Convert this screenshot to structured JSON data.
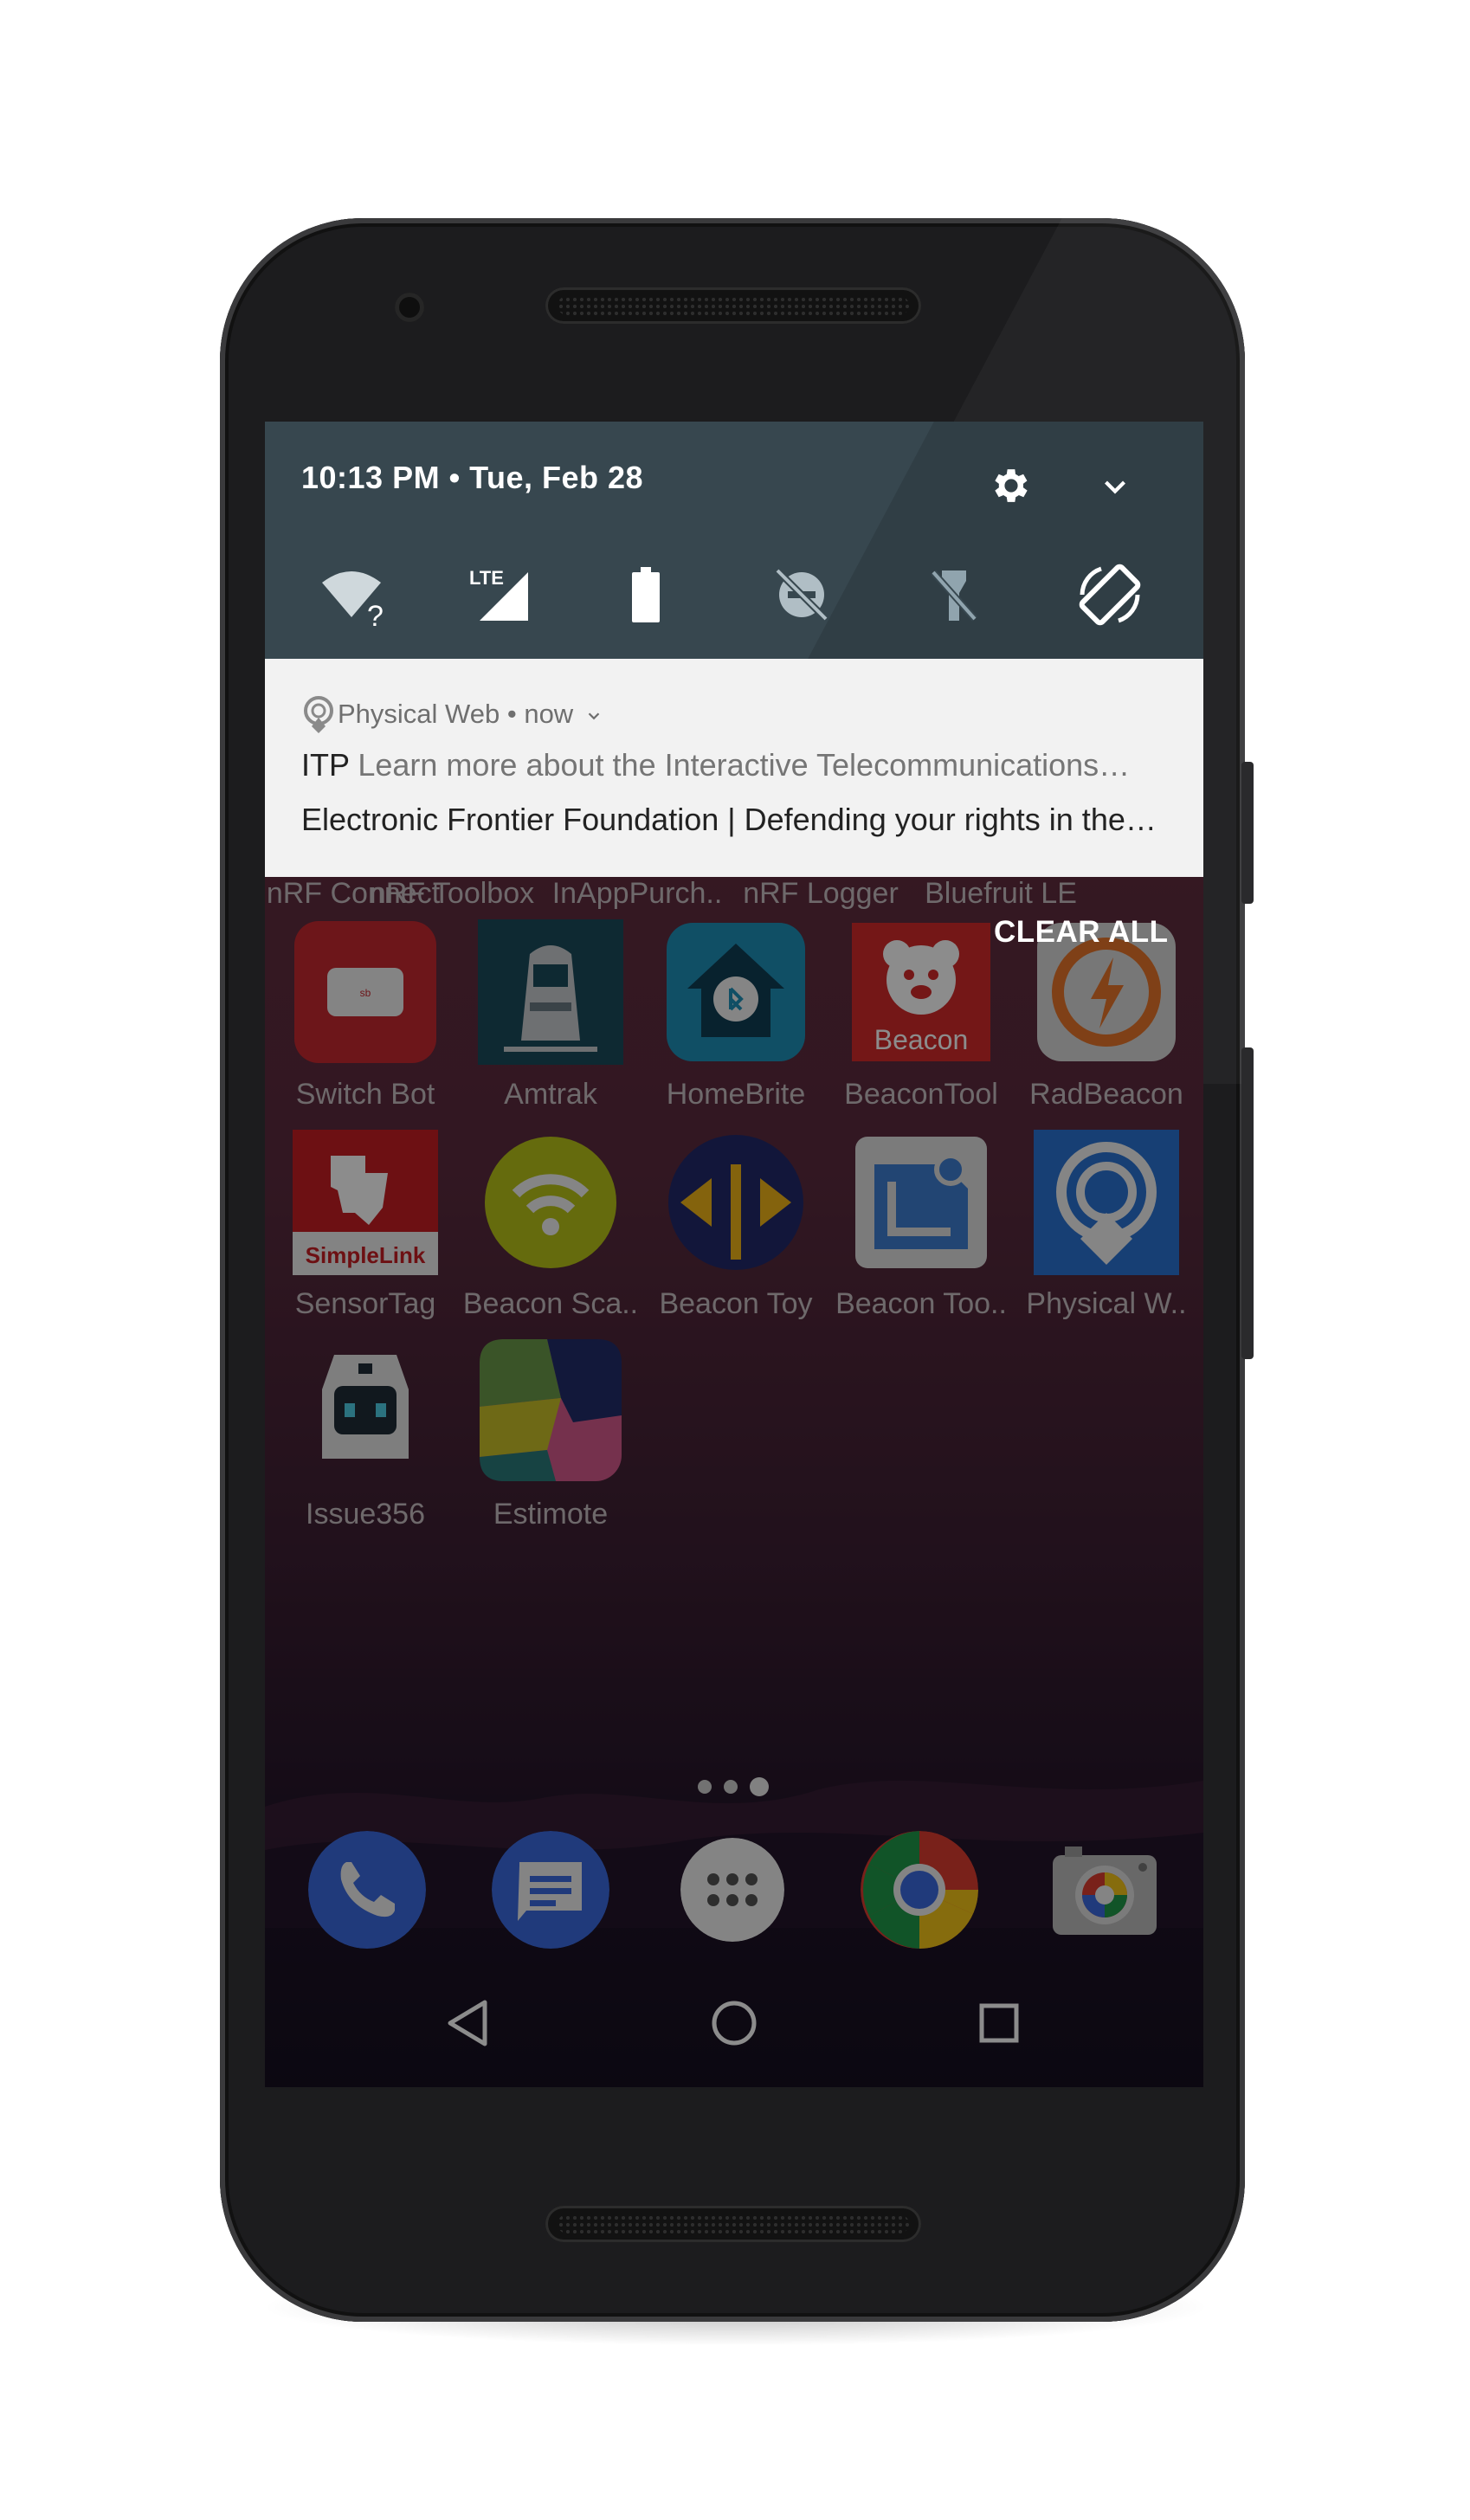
{
  "status_bar": {
    "time_date": "10:13 PM • Tue, Feb 28",
    "settings_icon": "gear-icon",
    "expand_icon": "chevron-down-icon"
  },
  "quick_settings": [
    {
      "name": "wifi",
      "icon": "wifi-question-icon"
    },
    {
      "name": "cellular",
      "icon": "lte-signal-icon",
      "badge": "LTE"
    },
    {
      "name": "battery",
      "icon": "battery-icon"
    },
    {
      "name": "do-not-disturb",
      "icon": "dnd-off-icon"
    },
    {
      "name": "flashlight",
      "icon": "flashlight-off-icon"
    },
    {
      "name": "auto-rotate",
      "icon": "auto-rotate-icon"
    }
  ],
  "notification": {
    "app_name": "Physical Web",
    "time": "now",
    "line1_title": "ITP",
    "line1_text": "Learn more about the Interactive Telecommunications…",
    "line2_text": "Electronic Frontier Foundation | Defending your rights in the…"
  },
  "clear_all_label": "CLEAR ALL",
  "partial_row_labels": [
    "nRF Connect",
    "nRF Toolbox",
    "InAppPurch..",
    "nRF Logger",
    "Bluefruit LE"
  ],
  "apps": [
    {
      "label": "Switch Bot",
      "icon": "switchbot-icon"
    },
    {
      "label": "Amtrak",
      "icon": "amtrak-train-icon"
    },
    {
      "label": "HomeBrite",
      "icon": "homebrite-icon"
    },
    {
      "label": "BeaconTool",
      "icon": "beacontool-bear-icon",
      "icon_text": "Beacon"
    },
    {
      "label": "RadBeacon",
      "icon": "radbeacon-bolt-icon"
    },
    {
      "label": "SensorTag",
      "icon": "ti-simplelink-icon",
      "icon_text": "SimpleLink"
    },
    {
      "label": "Beacon Sca..",
      "icon": "beacon-scanner-icon"
    },
    {
      "label": "Beacon Toy",
      "icon": "beacon-toy-icon"
    },
    {
      "label": "Beacon Too..",
      "icon": "beacon-tools-icon"
    },
    {
      "label": "Physical W..",
      "icon": "physical-web-icon"
    },
    {
      "label": "Issue356",
      "icon": "issue356-robot-icon"
    },
    {
      "label": "Estimote",
      "icon": "estimote-icon"
    }
  ],
  "dock": [
    {
      "name": "phone",
      "icon": "phone-icon"
    },
    {
      "name": "messages",
      "icon": "messages-icon"
    },
    {
      "name": "app-drawer",
      "icon": "app-drawer-icon"
    },
    {
      "name": "chrome",
      "icon": "chrome-icon"
    },
    {
      "name": "camera",
      "icon": "camera-icon"
    }
  ],
  "nav": [
    {
      "name": "back",
      "icon": "back-triangle-icon"
    },
    {
      "name": "home",
      "icon": "home-circle-icon"
    },
    {
      "name": "recents",
      "icon": "recents-square-icon"
    }
  ],
  "page_indicator": {
    "pages": 3,
    "active": 3
  }
}
